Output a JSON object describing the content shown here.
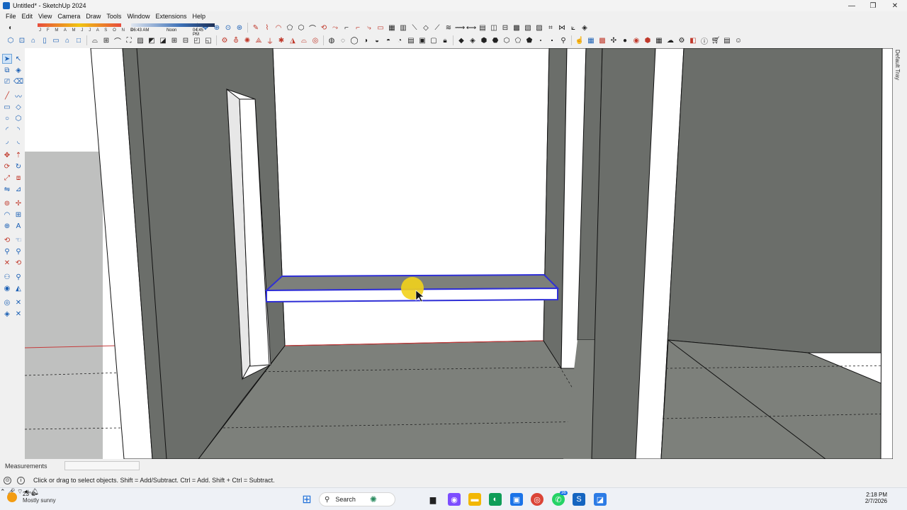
{
  "window": {
    "title": "Untitled* - SketchUp 2024",
    "controls": {
      "minimize": "—",
      "maximize": "❐",
      "close": "✕"
    }
  },
  "menu": [
    "File",
    "Edit",
    "View",
    "Camera",
    "Draw",
    "Tools",
    "Window",
    "Extensions",
    "Help"
  ],
  "shadow_settings": {
    "months": "J F M A M J J A S O N D",
    "time_start": "06:43 AM",
    "time_mid": "Noon",
    "time_end": "04:45 PM"
  },
  "tray": {
    "label": "Default Tray"
  },
  "measurements": {
    "label": "Measurements",
    "value": ""
  },
  "status": {
    "hint": "Click or drag to select objects. Shift = Add/Subtract. Ctrl = Add. Shift + Ctrl = Subtract."
  },
  "taskbar": {
    "weather_temp": "23°C",
    "weather_condition": "Mostly sunny",
    "search_placeholder": "Search",
    "whatsapp_badge": "36",
    "time": "2:18 PM",
    "date": "2/7/2026"
  },
  "colors": {
    "wall_gray": "#6b6e6a",
    "floor_gray": "#7d807b",
    "ground_gray": "#bfc0bf",
    "selection_blue": "#2f2fd6",
    "cursor_highlight": "#f2d21b"
  }
}
